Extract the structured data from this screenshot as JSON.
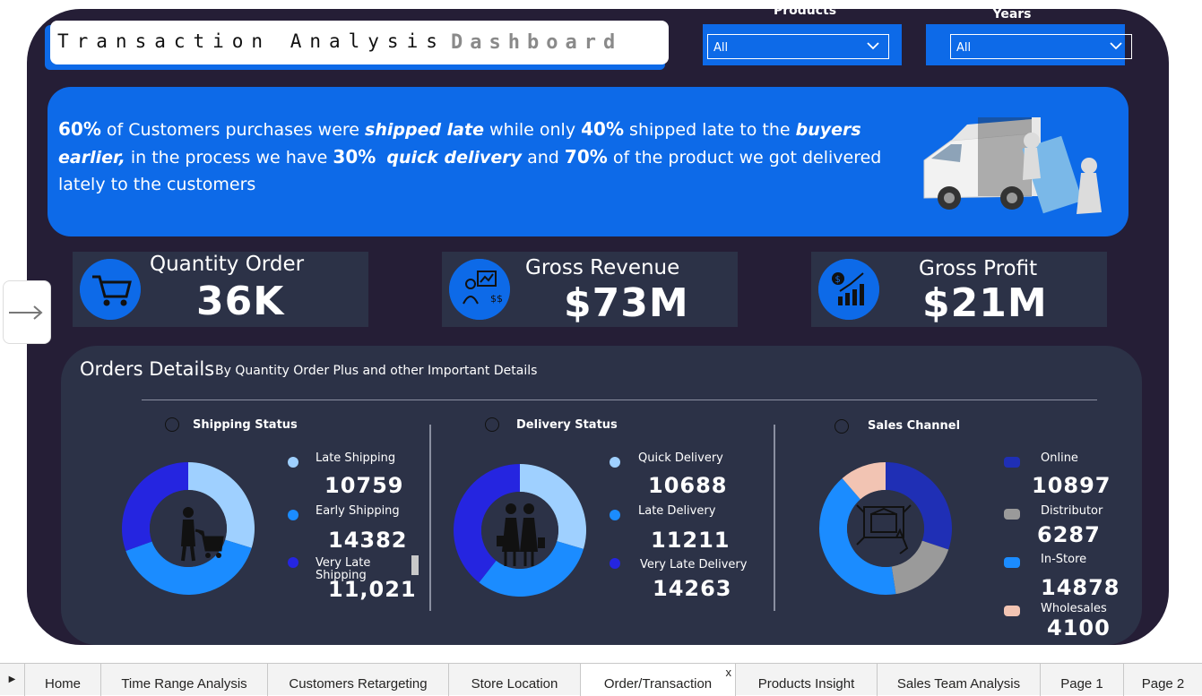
{
  "header": {
    "title_part1": "Transaction Analysis",
    "title_part2": "Dashboard"
  },
  "filters": {
    "products": {
      "label": "Products",
      "value": "All"
    },
    "years": {
      "label": "Years",
      "value": "All"
    }
  },
  "banner": {
    "p1": "60%",
    "t1": " of Customers purchases were ",
    "b1": "shipped late",
    "t2": " while only ",
    "p2": "40%",
    "t3": " shipped late to the ",
    "b2": "buyers earlier,",
    "t4": " in the process we have ",
    "p3": "30%",
    "b3": "quick delivery",
    "t5": " and ",
    "p4": "70%",
    "t6": " of the product we got delivered lately to the customers"
  },
  "kpis": {
    "quantity": {
      "label": "Quantity Order",
      "value": "36K",
      "icon": "shopping-cart-icon"
    },
    "revenue": {
      "label": "Gross Revenue",
      "value": "$73M",
      "icon": "revenue-presenter-icon"
    },
    "profit": {
      "label": "Gross Profit",
      "value": "$21M",
      "icon": "profit-chart-icon"
    }
  },
  "orders": {
    "title": "Orders Details",
    "subtitle": "By Quantity Order Plus and other Important Details"
  },
  "chart_data": [
    {
      "type": "pie",
      "title": "Shipping Status",
      "categories": [
        "Late Shipping",
        "Early Shipping",
        "Very Late Shipping"
      ],
      "values": [
        10759,
        14382,
        11021
      ],
      "labels": [
        "10759",
        "14382",
        "11,021"
      ],
      "colors": [
        "#9fd0ff",
        "#1b8cff",
        "#2525e0"
      ]
    },
    {
      "type": "pie",
      "title": "Delivery Status",
      "categories": [
        "Quick Delivery",
        "Late Delivery",
        "Very Late Delivery"
      ],
      "values": [
        10688,
        11211,
        14263
      ],
      "labels": [
        "10688",
        "11211",
        "14263"
      ],
      "colors": [
        "#9fd0ff",
        "#1b8cff",
        "#2525e0"
      ]
    },
    {
      "type": "pie",
      "title": "Sales Channel",
      "categories": [
        "Online",
        "Distributor",
        "In-Store",
        "Wholesales"
      ],
      "values": [
        10897,
        6287,
        14878,
        4100
      ],
      "labels": [
        "10897",
        "6287",
        "14878",
        "4100"
      ],
      "colors": [
        "#1f2fb5",
        "#9a9a9a",
        "#1b8cff",
        "#f2c4b3"
      ]
    }
  ],
  "tabs": [
    {
      "label": "Home"
    },
    {
      "label": "Time Range Analysis"
    },
    {
      "label": "Customers Retargeting"
    },
    {
      "label": "Store Location"
    },
    {
      "label": "Order/Transaction",
      "close": "x"
    },
    {
      "label": "Products Insight"
    },
    {
      "label": "Sales Team Analysis"
    },
    {
      "label": "Page 1"
    },
    {
      "label": "Page 2"
    }
  ]
}
